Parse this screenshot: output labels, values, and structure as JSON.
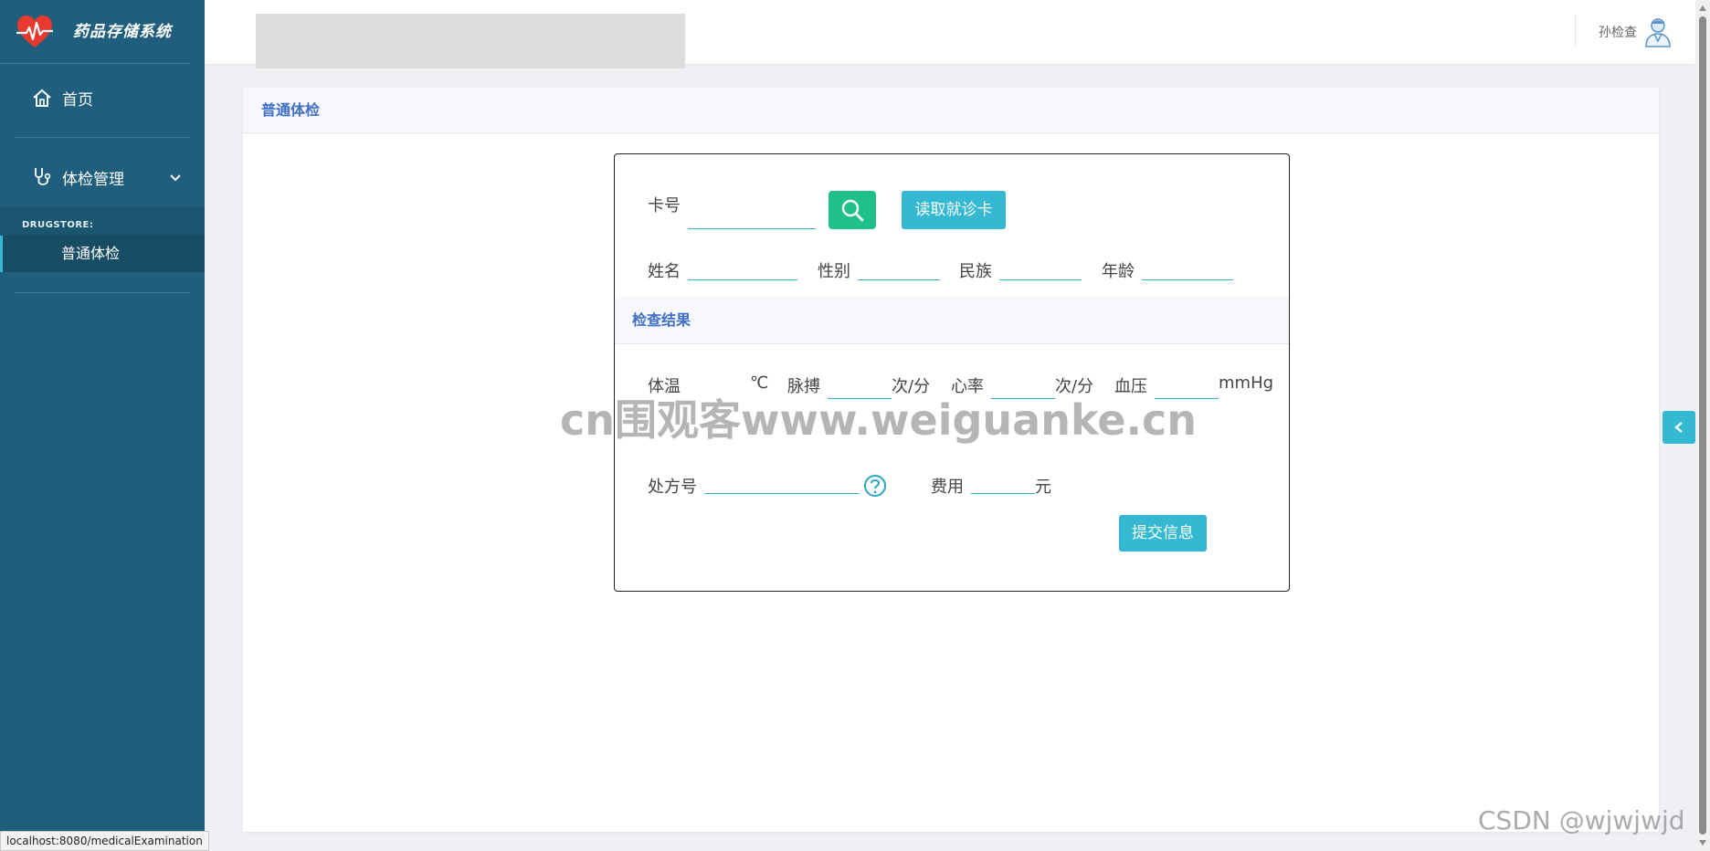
{
  "app": {
    "title": "药品存储系统",
    "brand_icon": "heart-pulse-icon"
  },
  "sidebar": {
    "home": {
      "label": "首页",
      "icon": "home-icon"
    },
    "exam_mgmt": {
      "label": "体检管理",
      "icon": "stethoscope-icon"
    },
    "submenu_head": "DRUGSTORE:",
    "sub_items": [
      {
        "label": "普通体检"
      }
    ]
  },
  "header": {
    "user_name": "孙检查",
    "avatar_icon": "doctor-avatar-icon"
  },
  "panel": {
    "title": "普通体检"
  },
  "form": {
    "card_label": "卡号",
    "card_value": "",
    "read_card_button": "读取就诊卡",
    "name_label": "姓名",
    "gender_label": "性别",
    "ethnicity_label": "民族",
    "age_label": "年龄",
    "results_title": "检查结果",
    "temp_label": "体温",
    "temp_unit": "℃",
    "pulse_label": "脉搏",
    "pulse_unit": "次/分",
    "heart_label": "心率",
    "heart_unit": "次/分",
    "bp_label": "血压",
    "bp_unit": "mmHg",
    "rx_label": "处方号",
    "fee_label": "费用",
    "fee_unit": "元",
    "submit_button": "提交信息"
  },
  "overlay": {
    "watermark": "cn围观客www.weiguanke.cn",
    "csdn": "CSDN @wjwjwjd",
    "status_url": "localhost:8080/medicalExamination"
  },
  "colors": {
    "sidebar": "#1f5f7d",
    "accent": "#35b9d3",
    "search_button": "#1fc08a",
    "title_blue": "#3f6fc8"
  }
}
